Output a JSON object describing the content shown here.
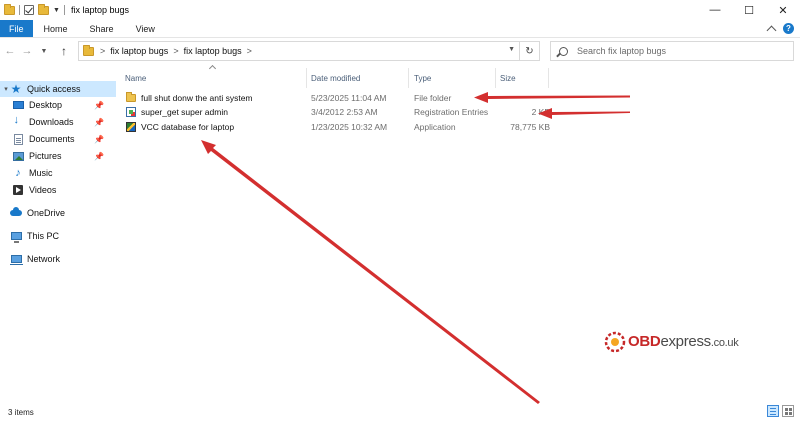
{
  "window": {
    "title": "fix laptop bugs",
    "controls": {
      "minimize": "—",
      "maximize": "☐",
      "close": "✕"
    }
  },
  "ribbon": {
    "tabs": [
      "File",
      "Home",
      "Share",
      "View"
    ]
  },
  "address": {
    "crumbs": [
      "fix laptop bugs",
      "fix laptop bugs"
    ],
    "separator": ">",
    "search_placeholder": "Search fix laptop bugs"
  },
  "sidebar": {
    "items": [
      {
        "label": "Quick access",
        "icon": "star-icon",
        "pinned": false
      },
      {
        "label": "Desktop",
        "icon": "desktop-icon",
        "pinned": true
      },
      {
        "label": "Downloads",
        "icon": "downloads-icon",
        "pinned": true
      },
      {
        "label": "Documents",
        "icon": "documents-icon",
        "pinned": true
      },
      {
        "label": "Pictures",
        "icon": "pictures-icon",
        "pinned": true
      },
      {
        "label": "Music",
        "icon": "music-icon",
        "pinned": false
      },
      {
        "label": "Videos",
        "icon": "videos-icon",
        "pinned": false
      },
      {
        "label": "OneDrive",
        "icon": "onedrive-icon",
        "pinned": false
      },
      {
        "label": "This PC",
        "icon": "this-pc-icon",
        "pinned": false
      },
      {
        "label": "Network",
        "icon": "network-icon",
        "pinned": false
      }
    ]
  },
  "filelist": {
    "columns": [
      "Name",
      "Date modified",
      "Type",
      "Size"
    ],
    "rows": [
      {
        "name": "full shut donw the anti system",
        "date": "5/23/2025 11:04 AM",
        "type": "File folder",
        "size": "",
        "icon": "folder-icon"
      },
      {
        "name": "super_get super admin",
        "date": "3/4/2012 2:53 AM",
        "type": "Registration Entries",
        "size": "2 KB",
        "icon": "registry-file-icon"
      },
      {
        "name": "VCC database for laptop",
        "date": "1/23/2025 10:32 AM",
        "type": "Application",
        "size": "78,775 KB",
        "icon": "application-icon"
      }
    ]
  },
  "status": {
    "item_count": "3 items"
  },
  "watermark": {
    "brand": "OBD",
    "rest": "express",
    "tld": ".co.uk"
  },
  "colors": {
    "accent": "#1979ca",
    "selection": "#cce8ff",
    "annotation_arrow": "#d32f2f"
  }
}
